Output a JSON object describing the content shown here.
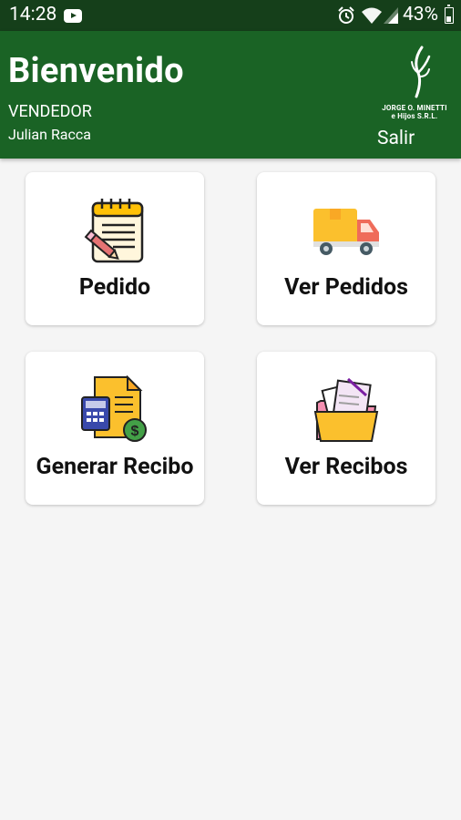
{
  "status_bar": {
    "time": "14:28",
    "battery_pct": "43%",
    "icons": [
      "youtube-icon",
      "alarm-icon",
      "wifi-icon",
      "signal-icon",
      "battery-icon"
    ]
  },
  "header": {
    "welcome": "Bienvenido",
    "role": "VENDEDOR",
    "user_name": "Julian Racca",
    "logo_text_line1": "JORGE O. MINETTI",
    "logo_text_line2": "e Hijos S.R.L.",
    "logout_label": "Salir"
  },
  "menu": [
    {
      "label": "Pedido",
      "icon": "notepad-pencil-icon"
    },
    {
      "label": "Ver Pedidos",
      "icon": "delivery-truck-icon"
    },
    {
      "label": "Generar Recibo",
      "icon": "calculator-invoice-icon"
    },
    {
      "label": "Ver Recibos",
      "icon": "folder-documents-icon"
    }
  ],
  "colors": {
    "status_bar": "#153f1a",
    "header": "#1a6325",
    "background": "#f5f5f5",
    "tile": "#ffffff"
  }
}
